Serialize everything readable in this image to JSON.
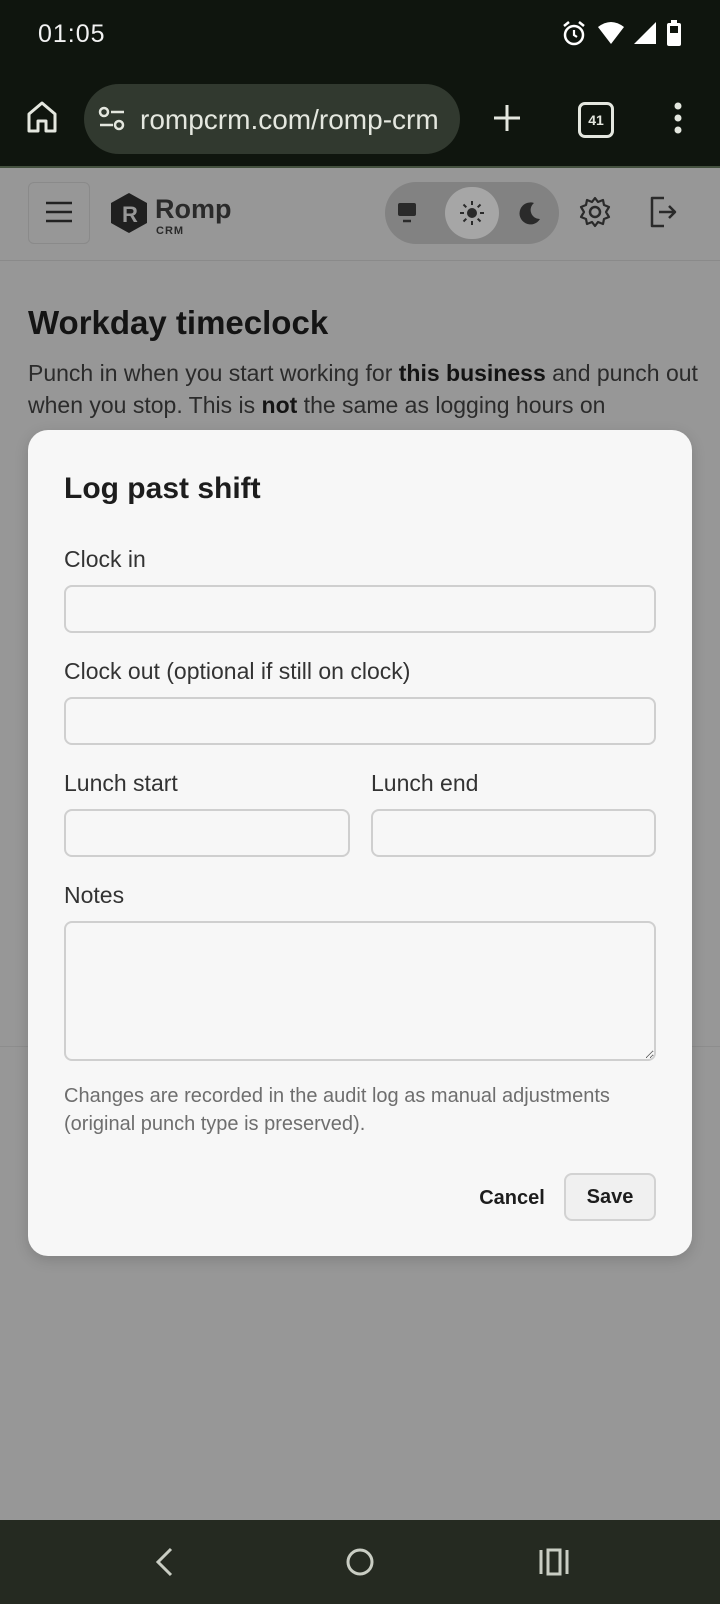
{
  "status_bar": {
    "time": "01:05",
    "icons": [
      "alarm-icon",
      "wifi-icon",
      "cellular-signal-icon",
      "battery-icon"
    ]
  },
  "browser": {
    "url": "rompcrm.com/romp-crm",
    "tab_count": "41",
    "icons": [
      "home-icon",
      "site-settings-icon",
      "new-tab-plus-icon",
      "tab-switcher-icon",
      "overflow-menu-icon"
    ]
  },
  "app": {
    "brand_name": "Romp",
    "brand_sub": "CRM",
    "theme_options": [
      "monitor-icon",
      "sun-icon",
      "moon-icon"
    ],
    "selected_theme": "light"
  },
  "page": {
    "title": "Workday timeclock",
    "description": {
      "p1": "Punch in when you start working for ",
      "b1": "this business",
      "p2": " and punch out when you stop. This is ",
      "b2": "not",
      "p3": " the same as logging hours on"
    }
  },
  "modal": {
    "title": "Log past shift",
    "clock_in_label": "Clock in",
    "clock_in_value": "",
    "clock_out_label": "Clock out (optional if still on clock)",
    "clock_out_value": "",
    "lunch_start_label": "Lunch start",
    "lunch_start_value": "",
    "lunch_end_label": "Lunch end",
    "lunch_end_value": "",
    "notes_label": "Notes",
    "notes_value": "",
    "hint": "Changes are recorded in the audit log as manual adjustments (original punch type is preserved).",
    "cancel_label": "Cancel",
    "save_label": "Save"
  },
  "nav_bar": {
    "icons": [
      "back-icon",
      "home-circle-icon",
      "recents-icon"
    ]
  },
  "colors": {
    "status_bg": "#0f150e",
    "overlay": "#979797",
    "modal_bg": "#f7f7f7",
    "nav_bg": "#252a21"
  }
}
